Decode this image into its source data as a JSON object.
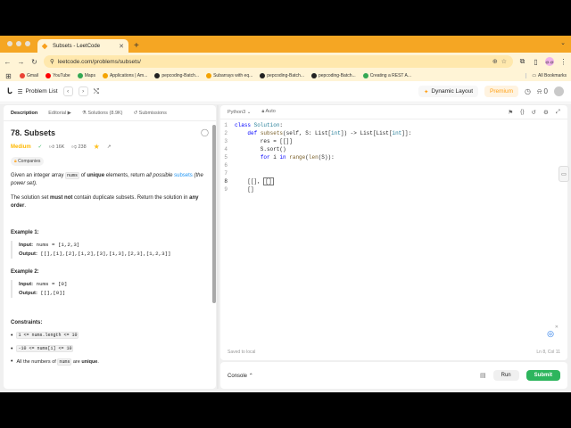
{
  "browser": {
    "tab_title": "Subsets - LeetCode",
    "url": "leetcode.com/problems/subsets/",
    "profile": "@.@"
  },
  "bookmarks": {
    "items": [
      "Gmail",
      "YouTube",
      "Maps",
      "Applications | Am...",
      "pepcoding-Batch...",
      "Subarrays with eq...",
      "pepcoding-Batch...",
      "pepcoding-Batch...",
      "Creating a REST A..."
    ],
    "all": "All Bookmarks",
    "colors": [
      "#ea4335",
      "#ff0000",
      "#34a853",
      "#f4a300",
      "#222222",
      "#f4a300",
      "#222222",
      "#222222",
      "#34a853"
    ]
  },
  "lc_nav": {
    "problem_list": "Problem List",
    "dynamic_layout": "Dynamic Layout",
    "premium": "Premium",
    "notif_count": "0"
  },
  "left_tabs": {
    "description": "Description",
    "editorial": "Editorial",
    "solutions": "Solutions (8.9K)",
    "submissions": "Submissions"
  },
  "problem": {
    "title": "78. Subsets",
    "difficulty": "Medium",
    "likes": "16K",
    "dislikes": "238",
    "companies": "Companies",
    "desc_1a": "Given an integer array ",
    "desc_1b": "nums",
    "desc_1c": " of ",
    "desc_1d": "unique",
    "desc_1e": " elements, return ",
    "desc_1f": "all possible",
    "desc_1g": " subsets",
    "desc_1h": " (the power set).",
    "desc_2a": "The solution set ",
    "desc_2b": "must not",
    "desc_2c": " contain duplicate subsets. Return the solution in ",
    "desc_2d": "any order",
    "desc_2e": ".",
    "ex1_title": "Example 1:",
    "ex1_input_label": "Input:",
    "ex1_input": " nums = [1,2,3]",
    "ex1_output_label": "Output:",
    "ex1_output": " [[],[1],[2],[1,2],[3],[1,3],[2,3],[1,2,3]]",
    "ex2_title": "Example 2:",
    "ex2_input_label": "Input:",
    "ex2_input": " nums = [0]",
    "ex2_output_label": "Output:",
    "ex2_output": " [[],[0]]",
    "constraints_title": "Constraints:",
    "c1": "1 <= nums.length <= 10",
    "c2": "-10 <= nums[i] <= 10",
    "c3a": "All the numbers of ",
    "c3b": "nums",
    "c3c": " are ",
    "c3d": "unique",
    "c3e": "."
  },
  "editor": {
    "language": "Python3",
    "mode": "Auto",
    "line_numbers": [
      "1",
      "2",
      "3",
      "4",
      "5",
      "6",
      "7",
      "8",
      "9"
    ],
    "l1_kw": "class",
    "l1_cls": " Solution",
    "l1_rest": ":",
    "l2_indent": "    ",
    "l2_kw": "def",
    "l2_fn": " subsets",
    "l2_a": "(self, S: List[",
    "l2_ty1": "int",
    "l2_b": "]) -> List[List[",
    "l2_ty2": "int",
    "l2_c": "]]:",
    "l3": "        res = [[]]",
    "l4": "        S.sort()",
    "l5_a": "        ",
    "l5_kw1": "for",
    "l5_b": " i ",
    "l5_kw2": "in",
    "l5_c": " ",
    "l5_fn1": "range",
    "l5_d": "(",
    "l5_fn2": "len",
    "l5_e": "(S)):",
    "l8_a": "    [[], ",
    "l8_b": "[]",
    "l9": "    []",
    "saved": "Saved to local",
    "position": "Ln 8, Col 11"
  },
  "console": {
    "label": "Console",
    "run": "Run",
    "submit": "Submit"
  }
}
